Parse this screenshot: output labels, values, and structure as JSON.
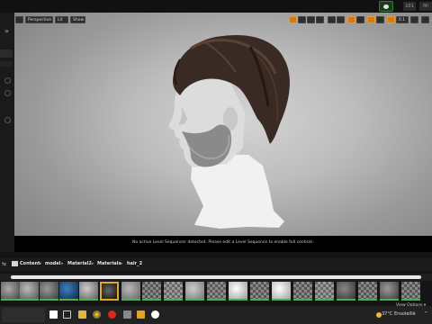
{
  "editor": {
    "top_label_left": "101",
    "top_label_right": "Mi"
  },
  "viewport": {
    "buttons": {
      "perspective": "Perspective",
      "lit": "Lit",
      "show": "Show",
      "scale": "0.1"
    },
    "message": "No active Level Sequencer detected. Please edit a Level Sequence to enable full controls."
  },
  "content_browser": {
    "breadcrumb": [
      "Content",
      "model",
      "Material2",
      "Materials",
      "hair_2"
    ],
    "view_options_label": "View Options ▾"
  },
  "taskbar": {
    "temperature": "37°C",
    "weather": "Ensoleillé"
  },
  "accent": {
    "selection": "#e0a82e",
    "asset_underline": "#4caf50",
    "toolbar_highlight": "#d27a1a"
  }
}
